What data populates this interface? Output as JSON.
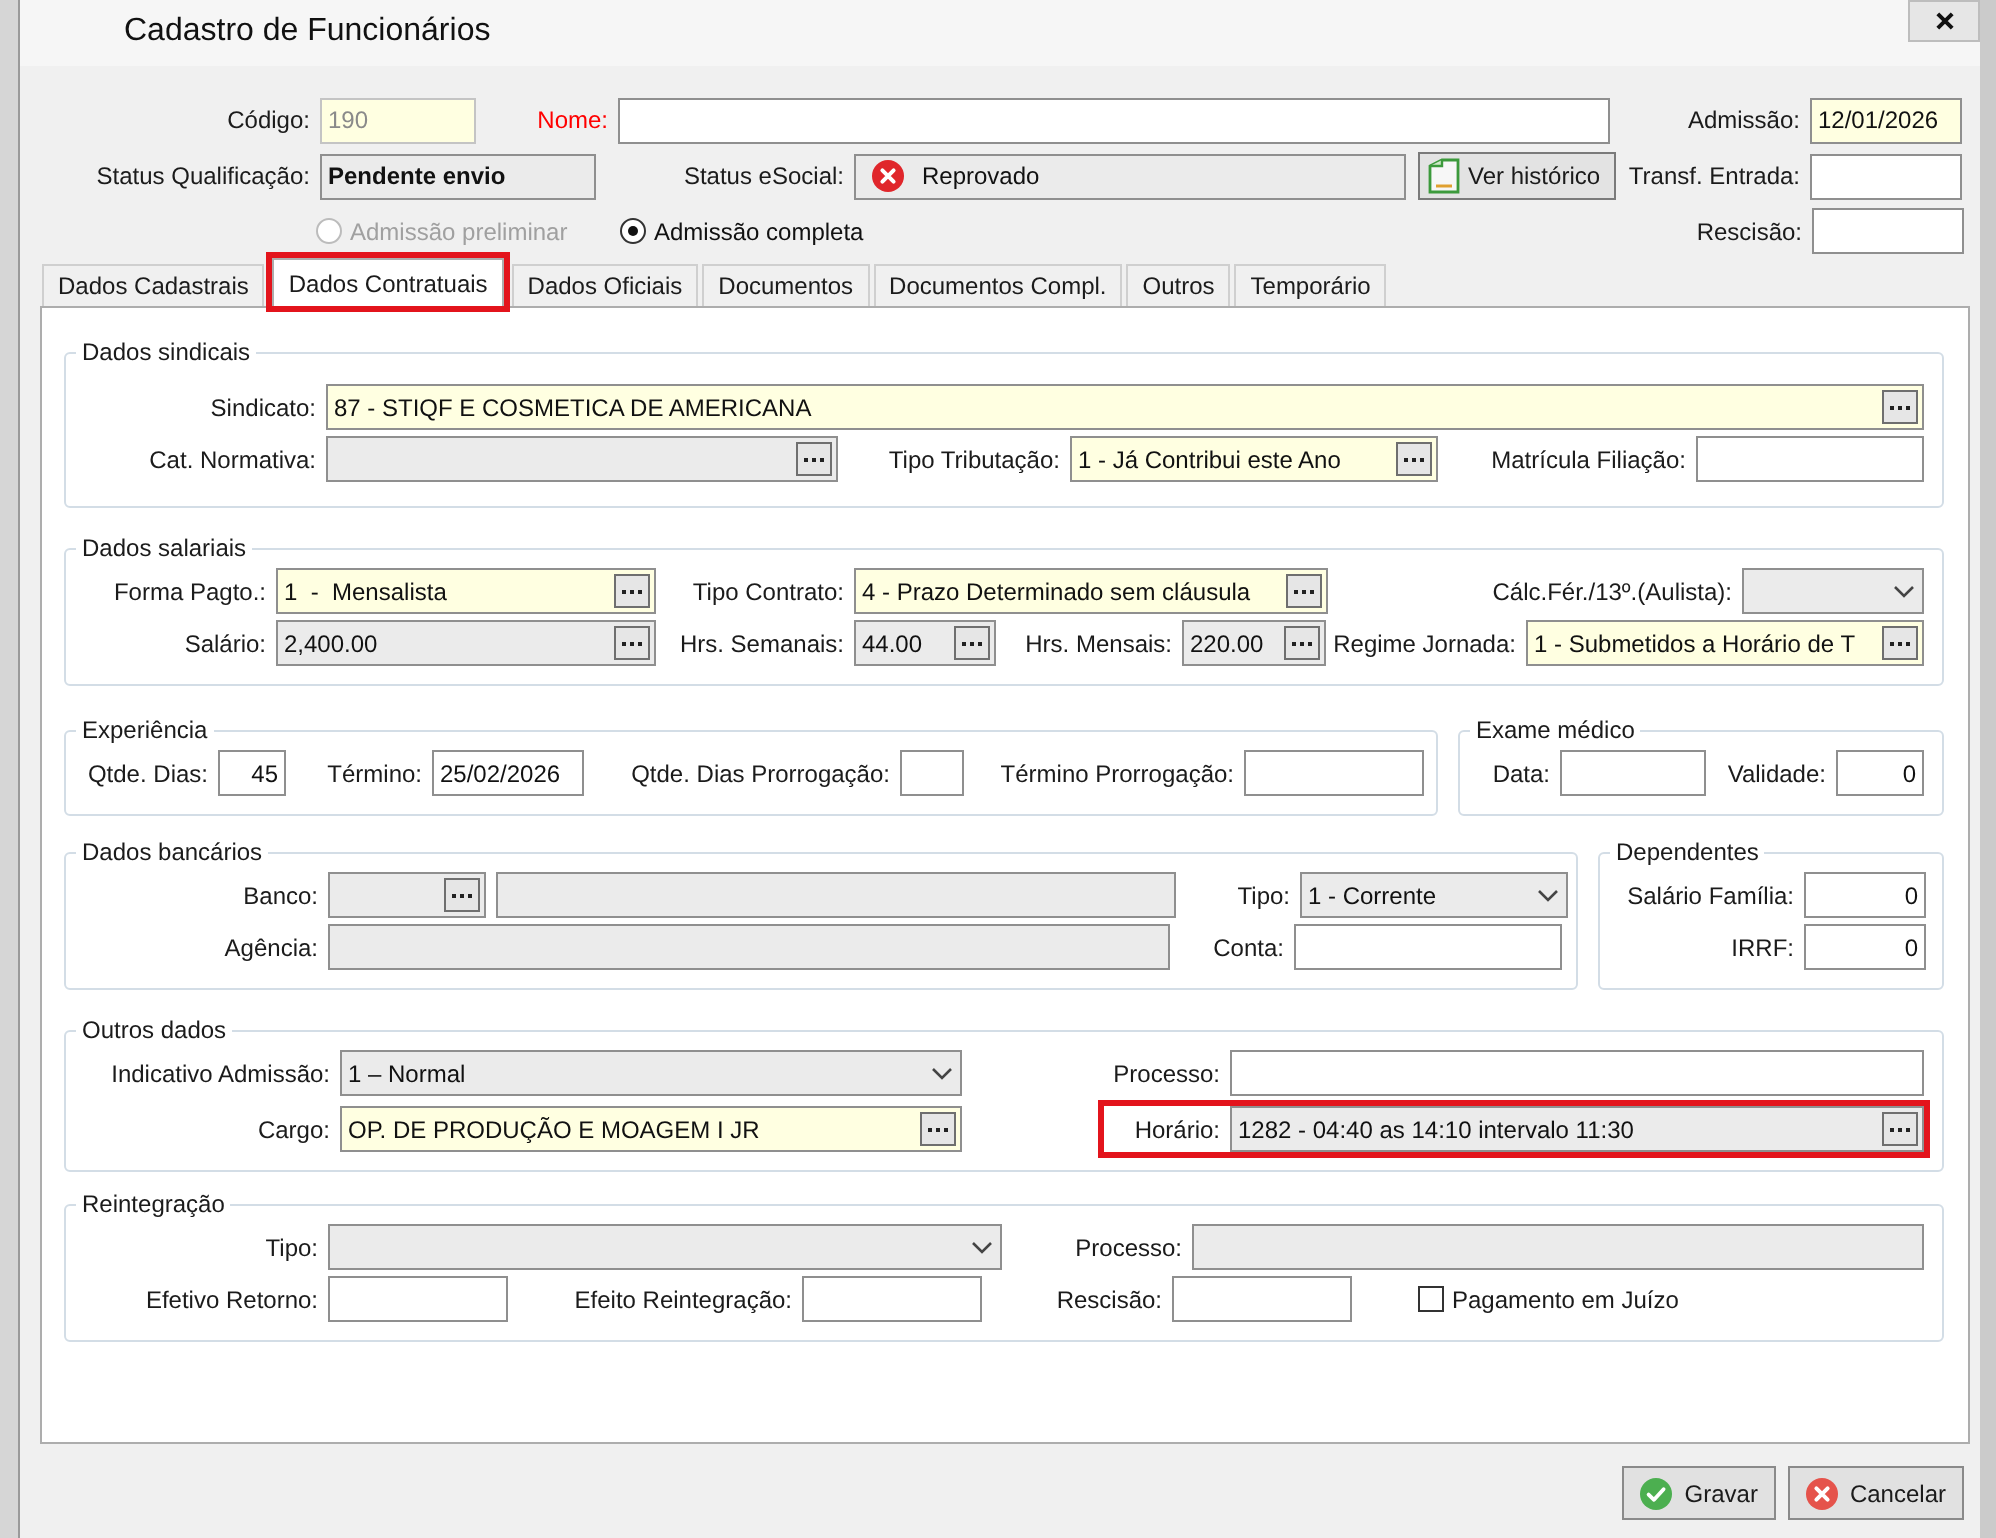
{
  "window": {
    "title": "Cadastro de Funcionários"
  },
  "header": {
    "fields": [
      {
        "label": "Código:",
        "value": "190",
        "kind": "text",
        "required": true,
        "readonly": false,
        "disabled": true,
        "alert": false
      },
      {
        "label": "Nome:",
        "kind": "text",
        "required": false,
        "readonly": false,
        "disabled": false,
        "alert": true
      },
      {
        "label": "Admissão:",
        "value": "12/01/2026",
        "kind": "text",
        "required": true,
        "readonly": false,
        "disabled": false,
        "alert": false
      },
      {
        "label": "Status Qualificação:",
        "value": "Pendente envio",
        "kind": "text",
        "required": false,
        "readonly": true,
        "disabled": false,
        "alert": false
      },
      {
        "label": "Status eSocial:",
        "value": "Reprovado",
        "kind": "status",
        "required": false,
        "readonly": true,
        "disabled": false,
        "alert": false
      },
      {
        "label": "Transf. Entrada:",
        "kind": "text",
        "required": false,
        "readonly": false,
        "disabled": false,
        "alert": false
      },
      {
        "label": "Rescisão:",
        "kind": "text",
        "required": false,
        "readonly": false,
        "disabled": false,
        "alert": false
      }
    ],
    "history_button": "Ver histórico",
    "admission_type": [
      {
        "label": "Admissão preliminar",
        "selected": false,
        "disabled": true
      },
      {
        "label": "Admissão completa",
        "selected": true,
        "disabled": false
      }
    ]
  },
  "tabs": [
    {
      "label": "Dados Cadastrais",
      "selected": false,
      "highlighted": false
    },
    {
      "label": "Dados Contratuais",
      "selected": true,
      "highlighted": true
    },
    {
      "label": "Dados Oficiais",
      "selected": false,
      "highlighted": false
    },
    {
      "label": "Documentos",
      "selected": false,
      "highlighted": false
    },
    {
      "label": "Documentos Compl.",
      "selected": false,
      "highlighted": false
    },
    {
      "label": "Outros",
      "selected": false,
      "highlighted": false
    },
    {
      "label": "Temporário",
      "selected": false,
      "highlighted": false
    }
  ],
  "groups": [
    {
      "title": "Dados sindicais",
      "fields": [
        {
          "label": "Sindicato:",
          "value": "87 - STIQF E COSMETICA DE AMERICANA",
          "kind": "lookup",
          "required": true,
          "readonly": false
        },
        {
          "label": "Cat. Normativa:",
          "kind": "lookup",
          "required": false,
          "readonly": true
        },
        {
          "label": "Tipo Tributação:",
          "value": "1 - Já Contribui este Ano",
          "kind": "lookup",
          "required": true,
          "readonly": false
        },
        {
          "label": "Matrícula Filiação:",
          "kind": "text",
          "required": false,
          "readonly": false
        }
      ]
    },
    {
      "title": "Dados salariais",
      "fields": [
        {
          "label": "Forma Pagto.:",
          "value": "1  -  Mensalista",
          "kind": "lookup",
          "required": true,
          "readonly": false
        },
        {
          "label": "Tipo Contrato:",
          "value": "4 - Prazo Determinado sem cláusula",
          "kind": "lookup",
          "required": true,
          "readonly": false
        },
        {
          "label": "Cálc.Fér./13º.(Aulista):",
          "kind": "select",
          "required": false,
          "readonly": true
        },
        {
          "label": "Salário:",
          "value": "2,400.00",
          "kind": "lookup",
          "required": false,
          "readonly": true
        },
        {
          "label": "Hrs. Semanais:",
          "value": "44.00",
          "kind": "lookup",
          "required": false,
          "readonly": true
        },
        {
          "label": "Hrs. Mensais:",
          "value": "220.00",
          "kind": "lookup",
          "required": false,
          "readonly": true
        },
        {
          "label": "Regime Jornada:",
          "value": "1 - Submetidos a Horário de T",
          "kind": "lookup",
          "required": true,
          "readonly": false
        }
      ]
    },
    {
      "title": "Experiência",
      "fields": [
        {
          "label": "Qtde. Dias:",
          "value": "45",
          "kind": "text",
          "required": false,
          "readonly": false
        },
        {
          "label": "Término:",
          "value": "25/02/2026",
          "kind": "text",
          "required": false,
          "readonly": false
        },
        {
          "label": "Qtde. Dias Prorrogação:",
          "kind": "text",
          "required": false,
          "readonly": false
        },
        {
          "label": "Término Prorrogação:",
          "kind": "text",
          "required": false,
          "readonly": false
        }
      ]
    },
    {
      "title": "Exame médico",
      "fields": [
        {
          "label": "Data:",
          "kind": "text",
          "required": false,
          "readonly": false
        },
        {
          "label": "Validade:",
          "value": "0",
          "kind": "text",
          "required": false,
          "readonly": false
        }
      ]
    },
    {
      "title": "Dados bancários",
      "fields": [
        {
          "label": "Banco:",
          "kind": "lookup",
          "required": false,
          "readonly": true
        },
        {
          "kind": "text",
          "required": false,
          "readonly": true
        },
        {
          "label": "Tipo:",
          "value": "1 - Corrente",
          "kind": "select",
          "required": false,
          "readonly": true
        },
        {
          "label": "Agência:",
          "kind": "text",
          "required": false,
          "readonly": true
        },
        {
          "label": "Conta:",
          "kind": "text",
          "required": false,
          "readonly": false
        }
      ]
    },
    {
      "title": "Dependentes",
      "fields": [
        {
          "label": "Salário Família:",
          "value": "0",
          "kind": "text",
          "required": false,
          "readonly": false
        },
        {
          "label": "IRRF:",
          "value": "0",
          "kind": "text",
          "required": false,
          "readonly": false
        }
      ]
    },
    {
      "title": "Outros dados",
      "fields": [
        {
          "label": "Indicativo Admissão:",
          "value": "1 – Normal",
          "kind": "select",
          "required": false,
          "readonly": true,
          "highlighted": false
        },
        {
          "label": "Processo:",
          "kind": "text",
          "required": false,
          "readonly": false,
          "highlighted": false
        },
        {
          "label": "Cargo:",
          "value": "OP. DE PRODUÇÃO E MOAGEM I JR",
          "kind": "lookup",
          "required": true,
          "readonly": false,
          "highlighted": false
        },
        {
          "label": "Horário:",
          "value": "1282 - 04:40 as 14:10 intervalo 11:30",
          "kind": "lookup",
          "required": false,
          "readonly": true,
          "highlighted": true
        }
      ]
    },
    {
      "title": "Reintegração",
      "fields": [
        {
          "label": "Tipo:",
          "kind": "select",
          "required": false,
          "readonly": true
        },
        {
          "label": "Processo:",
          "kind": "text",
          "required": false,
          "readonly": true
        },
        {
          "label": "Efetivo Retorno:",
          "kind": "text",
          "required": false,
          "readonly": false
        },
        {
          "label": "Efeito Reintegração:",
          "kind": "text",
          "required": false,
          "readonly": false
        },
        {
          "label": "Rescisão:",
          "kind": "text",
          "required": false,
          "readonly": false
        },
        {
          "label": "Pagamento em Juízo",
          "kind": "checkbox",
          "checked": false
        }
      ]
    }
  ],
  "buttons": [
    {
      "label": "Gravar",
      "kind": "save"
    },
    {
      "label": "Cancelar",
      "kind": "cancel"
    }
  ]
}
